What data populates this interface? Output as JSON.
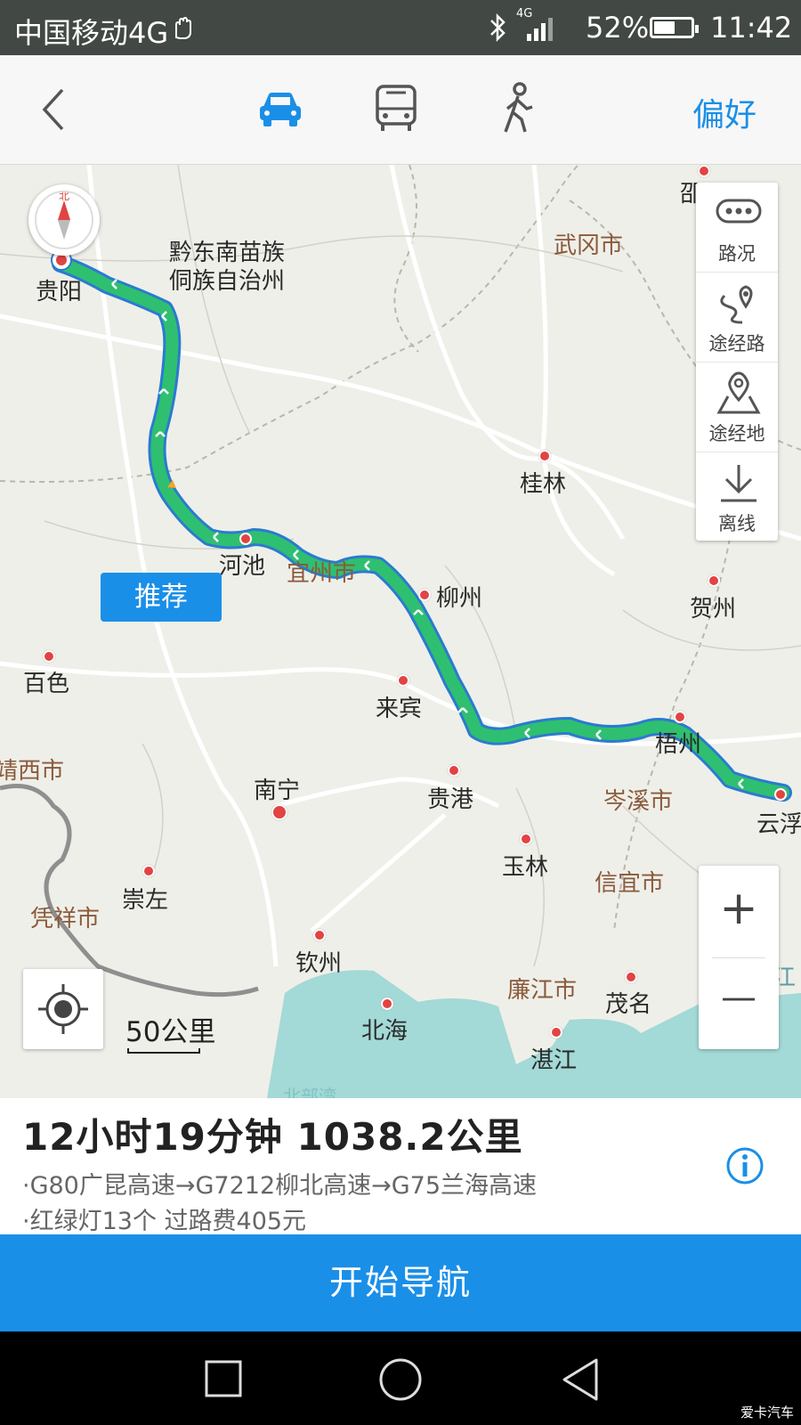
{
  "status_bar": {
    "carrier": "中国移动4G",
    "network": "4G",
    "battery_pct": "52%",
    "battery_level": 0.52,
    "time": "11:42"
  },
  "top_nav": {
    "modes": [
      {
        "icon": "car-icon",
        "active": true
      },
      {
        "icon": "bus-icon",
        "active": false
      },
      {
        "icon": "walk-icon",
        "active": false
      }
    ],
    "preference": "偏好"
  },
  "map": {
    "compass_label": "北",
    "recommend_tag": "推荐",
    "cities": {
      "guiyang": "贵阳",
      "qiandongnan": "黔东南苗族",
      "qiandongnan2": "侗族自治州",
      "wugang": "武冈市",
      "shao": "邵",
      "guilin": "桂林",
      "hechi": "河池",
      "yizhou": "宜州市",
      "liuzhou": "柳州",
      "hezhou": "贺州",
      "baise": "百色",
      "laibin": "来宾",
      "wuzhou": "梧州",
      "jingxi": "靖西市",
      "nanning": "南宁",
      "guigang": "贵港",
      "cenxi": "岑溪市",
      "yunfu": "云浮",
      "yulin": "玉林",
      "chongzuo": "崇左",
      "xinyi": "信宜市",
      "pingxiang": "凭祥市",
      "qinzhou": "钦州",
      "lianjiang": "廉江市",
      "maoming": "茂名",
      "beihai": "北海",
      "zhanjiang": "湛江",
      "yangjiang": "阳江",
      "beibuwan": "北部湾"
    },
    "scale": "50公里"
  },
  "side_panel": {
    "traffic": "路况",
    "via_road": "途经路",
    "via_place": "途经地",
    "offline": "离线"
  },
  "zoom": {
    "plus": "+",
    "minus": "—"
  },
  "summary": {
    "title": "12小时19分钟  1038.2公里",
    "route": "·G80广昆高速→G7212柳北高速→G75兰海高速",
    "extra": "·红绿灯13个  过路费405元"
  },
  "start_button": "开始导航",
  "watermark": "爱卡汽车",
  "colors": {
    "accent": "#1a8fe8",
    "route": "#2fbf71",
    "status_bar": "#424843"
  }
}
